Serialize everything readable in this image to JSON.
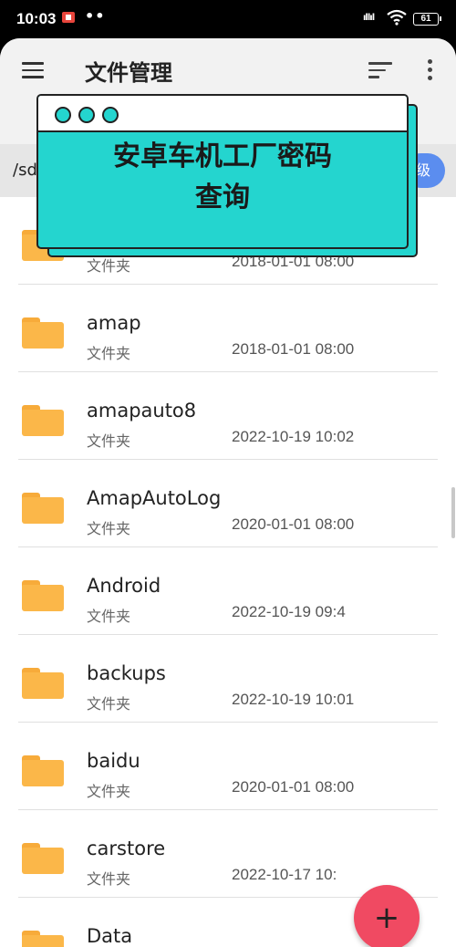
{
  "status_bar": {
    "time": "10:03",
    "dots": "••",
    "signal": "ıllıl",
    "battery": "61"
  },
  "toolbar": {
    "title": "文件管理"
  },
  "path_bar": {
    "path": "/sd",
    "up_label": "级"
  },
  "banner": {
    "line1": "安卓车机工厂密码",
    "line2": "查询",
    "accent_color": "#24d5cf"
  },
  "files": [
    {
      "name": "",
      "type": "文件夹",
      "date": "2018-01-01 08:00"
    },
    {
      "name": "amap",
      "type": "文件夹",
      "date": "2018-01-01 08:00"
    },
    {
      "name": "amapauto8",
      "type": "文件夹",
      "date": "2022-10-19 10:02"
    },
    {
      "name": "AmapAutoLog",
      "type": "文件夹",
      "date": "2020-01-01 08:00"
    },
    {
      "name": "Android",
      "type": "文件夹",
      "date": "2022-10-19 09:4"
    },
    {
      "name": "backups",
      "type": "文件夹",
      "date": "2022-10-19 10:01"
    },
    {
      "name": "baidu",
      "type": "文件夹",
      "date": "2020-01-01 08:00"
    },
    {
      "name": "carstore",
      "type": "文件夹",
      "date": "2022-10-17 10:"
    },
    {
      "name": "Data",
      "type": "",
      "date": ""
    }
  ],
  "fab": {
    "label": "+",
    "color": "#f04a62"
  }
}
